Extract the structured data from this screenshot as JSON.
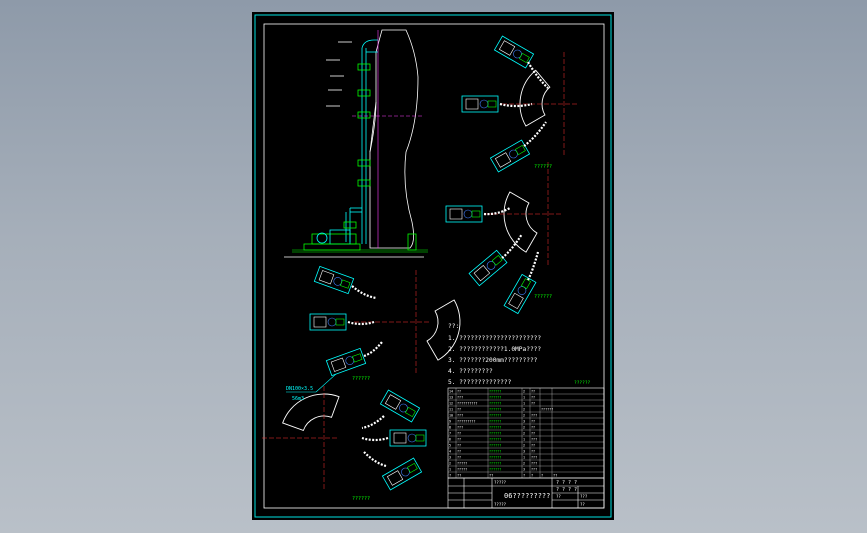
{
  "viewer": {
    "background_colors": [
      "#8e9aa9",
      "#b9c0c8"
    ]
  },
  "drawing": {
    "colors": {
      "background": "#000000",
      "border": "#00e0e0",
      "green": "#00ff00",
      "cyan": "#00ffff",
      "red": "#ff3030",
      "magenta": "#ff40ff",
      "blue": "#4080ff",
      "white": "#ffffff",
      "yellow": "#ffff00"
    },
    "view_labels": [
      "??????",
      "??????",
      "??????",
      "??????"
    ],
    "pipe_label_1": "DN100×3.5",
    "pipe_label_2": "56m3",
    "notes_title": "??:",
    "notes": [
      "1. ??????????????????????",
      "2. ????????????1.0MPa????",
      "3. ???????200mm?????????",
      "4. ?????????",
      "5. ??????????????"
    ],
    "notes_suffix": "??????",
    "bom_rows": [
      [
        "14",
        "??",
        "??????",
        "2",
        "??",
        ""
      ],
      [
        "13",
        "???",
        "??????",
        "1",
        "??",
        ""
      ],
      [
        "12",
        "??????????",
        "??????",
        "1",
        "??",
        ""
      ],
      [
        "11",
        "??",
        "??????",
        "2",
        "",
        "??????"
      ],
      [
        "10",
        "???",
        "??????",
        "2",
        "???",
        ""
      ],
      [
        "9",
        "?????????",
        "??????",
        "3",
        "??",
        ""
      ],
      [
        "8",
        "???",
        "??????",
        "2",
        "??",
        ""
      ],
      [
        "7",
        "??",
        "??????",
        "2",
        "??",
        ""
      ],
      [
        "6",
        "??",
        "??????",
        "1",
        "???",
        ""
      ],
      [
        "5",
        "??",
        "??????",
        "2",
        "??",
        ""
      ],
      [
        "4",
        "??",
        "??????",
        "3",
        "??",
        ""
      ],
      [
        "3",
        "??",
        "??????",
        "1",
        "???",
        ""
      ],
      [
        "2",
        "?????",
        "??????",
        "2",
        "???",
        ""
      ],
      [
        "1",
        "?????",
        "??????",
        "3",
        "???",
        ""
      ]
    ],
    "bom_header": [
      "?",
      "??",
      "??",
      "?",
      "?",
      "?",
      "??"
    ],
    "title_block_main": "06?????????",
    "title_block_cells": [
      "?????",
      "?????",
      "? ? ? ?",
      "? ? ? ?",
      "??",
      "???",
      "??"
    ]
  }
}
